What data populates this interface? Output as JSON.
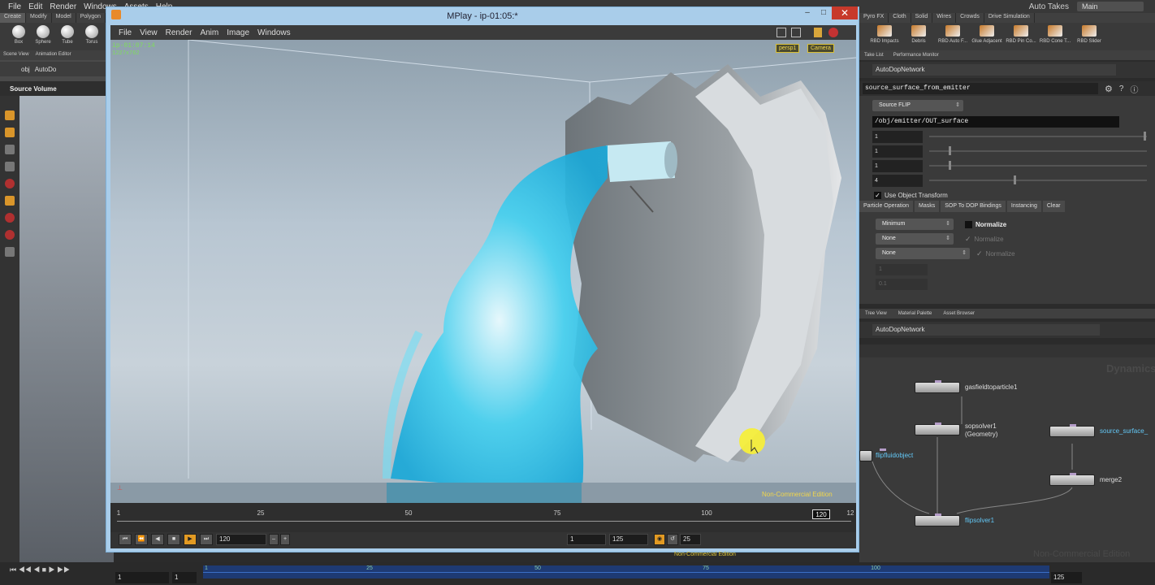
{
  "host": {
    "menus": [
      "File",
      "Edit",
      "Render",
      "Windows",
      "Assets",
      "Help"
    ],
    "auto_takes": "Auto Takes",
    "take": "Main",
    "shelf_tabs_left": [
      "Create",
      "Modify",
      "Model",
      "Polygon"
    ],
    "shelf_tools_left": [
      "Box",
      "Sphere",
      "Tube",
      "Torus"
    ],
    "shelf_tabs_right": [
      "Pyro FX",
      "Cloth",
      "Solid",
      "Wires",
      "Crowds",
      "Drive Simulation"
    ],
    "shelf_tools_right": [
      "RBD Impacts",
      "Debris",
      "RBD Auto F...",
      "Glue Adjacent",
      "RBD Pin Co...",
      "RBD Cone T...",
      "RBD Slider"
    ]
  },
  "left_pane": {
    "tabs": [
      "Scene View",
      "Animation Editor"
    ],
    "path": [
      "obj",
      "AutoDo"
    ],
    "viewport_label": "Source Volume"
  },
  "mplay": {
    "title": "MPlay - ip-01:05:*",
    "menus": [
      "File",
      "View",
      "Render",
      "Anim",
      "Image",
      "Windows"
    ],
    "frame_label": "ip-01:07:14",
    "resolution": "1227x762",
    "view_selectors": [
      "persp1",
      "Camera"
    ],
    "watermark": "Non-Commercial Edition",
    "timeline_ticks": [
      "1",
      "25",
      "50",
      "75",
      "100",
      "12"
    ],
    "current_frame": "120",
    "frame_field": "120",
    "start_frame": "1",
    "end_frame": "125",
    "fps": "25",
    "bottom_watermark": "Non-Commercial Edition"
  },
  "right_pane": {
    "tabs_top": [
      "Take List",
      "Performance Monitor"
    ],
    "network_path_top": "AutoDopNetwork",
    "node_name": "source_surface_from_emitter",
    "source_type": "Source FLIP",
    "sop_path": "/obj/emitter/OUT_surface",
    "numeric_fields": [
      "1",
      "1",
      "1",
      "4"
    ],
    "use_object_transform": "Use Object Transform",
    "param_tabs": [
      "Particle Operation",
      "Masks",
      "SOP To DOP Bindings",
      "Instancing",
      "Clear"
    ],
    "dropdowns": [
      "Minimum",
      "None",
      "None"
    ],
    "normalize_labels": [
      "Normalize",
      "Normalize",
      "Normalize"
    ],
    "faded_fields": [
      "1",
      "0.1"
    ],
    "tabs_bottom": [
      "Tree View",
      "Material Palette",
      "Asset Browser"
    ],
    "network_path_bottom": "AutoDopNetwork",
    "watermark_dynamics": "Dynamics",
    "watermark_nc": "Non-Commercial Edition",
    "nodes": [
      {
        "name": "gasfieldtoparticle1"
      },
      {
        "name": "sopsolver1\n(Geometry)"
      },
      {
        "name": "flipfluidobject"
      },
      {
        "name": "source_surface_"
      },
      {
        "name": "merge2"
      },
      {
        "name": "flipsolver1"
      }
    ]
  },
  "host_timeline": {
    "ticks": [
      "1",
      "25",
      "50",
      "75",
      "100"
    ],
    "start": "1",
    "field": "1",
    "end_field": "125"
  }
}
